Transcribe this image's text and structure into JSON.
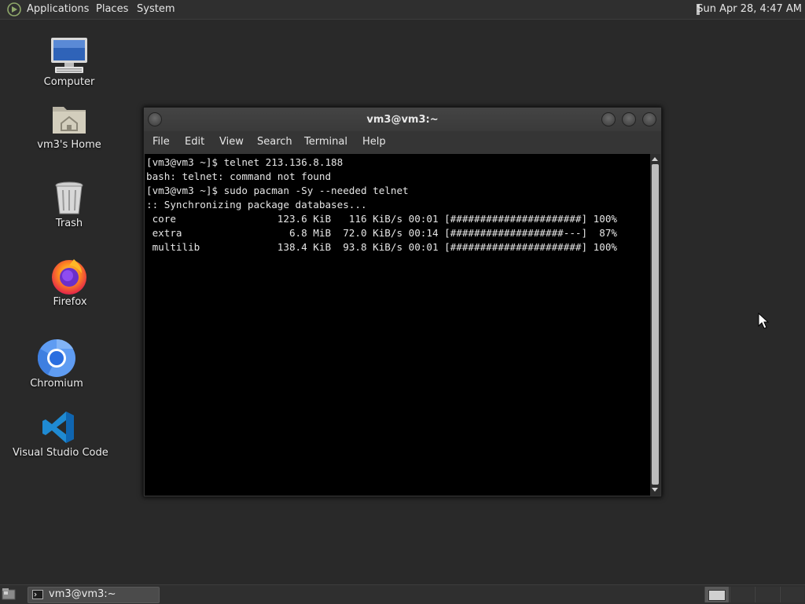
{
  "top_panel": {
    "menus": [
      "Applications",
      "Places",
      "System"
    ],
    "clock": "Sun Apr 28,  4:47 AM"
  },
  "desktop_icons": [
    {
      "label": "Computer",
      "icon": "computer-icon"
    },
    {
      "label": "vm3's Home",
      "icon": "home-folder-icon"
    },
    {
      "label": "Trash",
      "icon": "trash-icon"
    },
    {
      "label": "Firefox",
      "icon": "firefox-icon"
    },
    {
      "label": "Chromium",
      "icon": "chromium-icon"
    },
    {
      "label": "Visual Studio Code",
      "icon": "vscode-icon"
    }
  ],
  "terminal": {
    "title": "vm3@vm3:~",
    "menu": [
      "File",
      "Edit",
      "View",
      "Search",
      "Terminal",
      "Help"
    ],
    "output": "[vm3@vm3 ~]$ telnet 213.136.8.188\nbash: telnet: command not found\n[vm3@vm3 ~]$ sudo pacman -Sy --needed telnet\n:: Synchronizing package databases...\n core                 123.6 KiB   116 KiB/s 00:01 [######################] 100%\n extra                  6.8 MiB  72.0 KiB/s 00:14 [###################---]  87%\n multilib             138.4 KiB  93.8 KiB/s 00:01 [######################] 100%"
  },
  "taskbar": {
    "task_label": "vm3@vm3:~"
  }
}
